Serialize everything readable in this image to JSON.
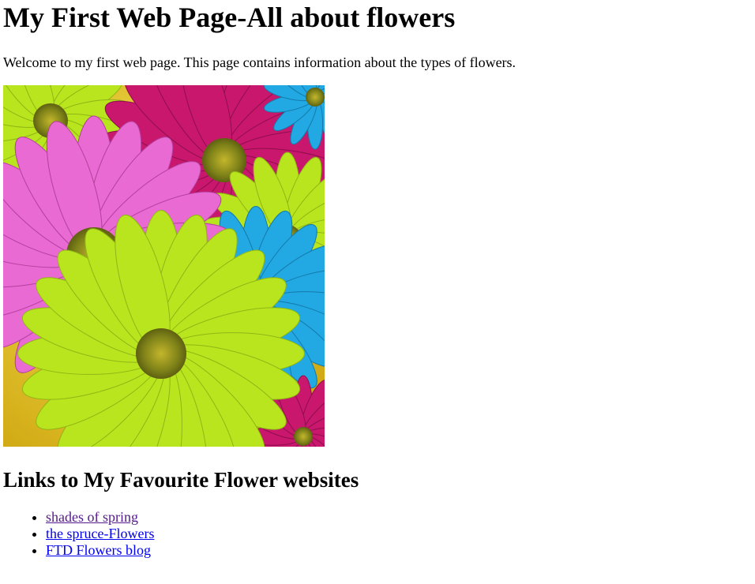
{
  "header": {
    "title": "My First Web Page-All about flowers"
  },
  "intro": {
    "text": "Welcome to my first web page. This page contains information about the types of flowers."
  },
  "image": {
    "subject": "colorful-daisy-flowers",
    "colors": {
      "pink": "#e86ad2",
      "magenta": "#c8176d",
      "blue": "#22a9e4",
      "lime": "#b9e51f",
      "yellow": "#f2c021",
      "center": "#8a8d1d"
    }
  },
  "links": {
    "heading": "Links to My Favourite Flower websites",
    "items": [
      {
        "label": "shades of spring",
        "visited": true
      },
      {
        "label": "the spruce-Flowers",
        "visited": false
      },
      {
        "label": "FTD Flowers blog",
        "visited": false
      }
    ]
  },
  "colors": {
    "link": "#0000ee",
    "visited_link": "#551a8b",
    "text": "#000000",
    "background": "#ffffff"
  }
}
